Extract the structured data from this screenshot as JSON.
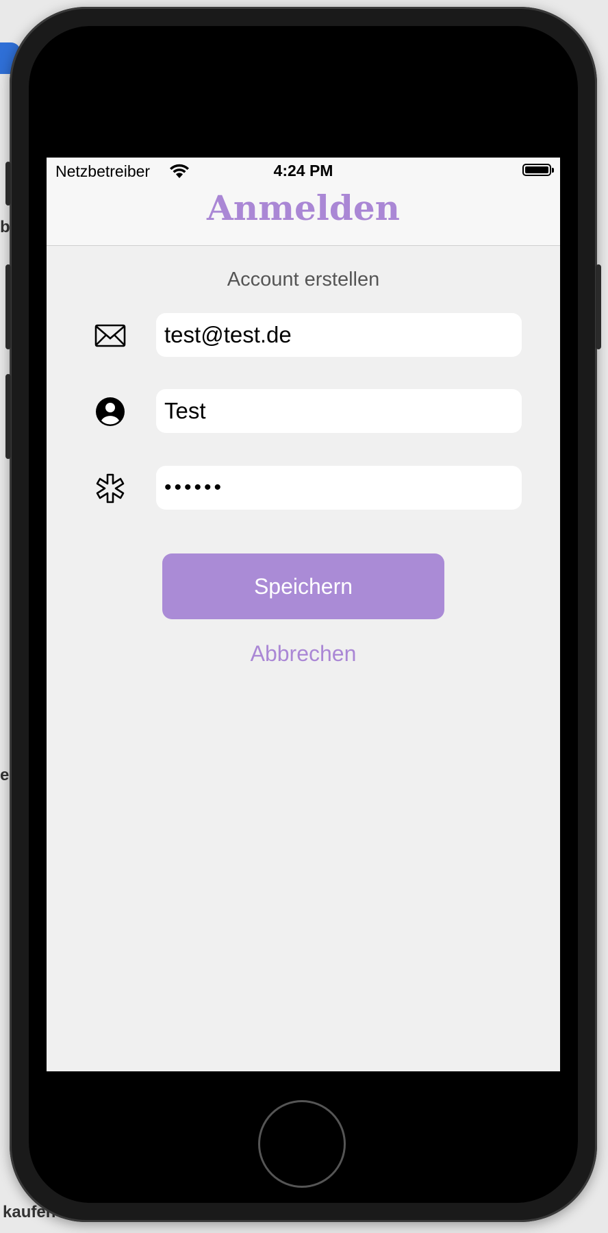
{
  "background": {
    "partial_word_1": "be",
    "partial_word_2": "e",
    "partial_word_3": "kaufen"
  },
  "statusbar": {
    "carrier": "Netzbetreiber",
    "time": "4:24 PM"
  },
  "navbar": {
    "title": "Anmelden"
  },
  "form": {
    "subtitle": "Account erstellen",
    "email_value": "test@test.de",
    "username_value": "Test",
    "password_value": "••••••",
    "save_label": "Speichern",
    "cancel_label": "Abbrechen"
  },
  "colors": {
    "accent": "#aa87d5",
    "button": "#aa8bd6",
    "screen_bg": "#f0f0f0"
  }
}
